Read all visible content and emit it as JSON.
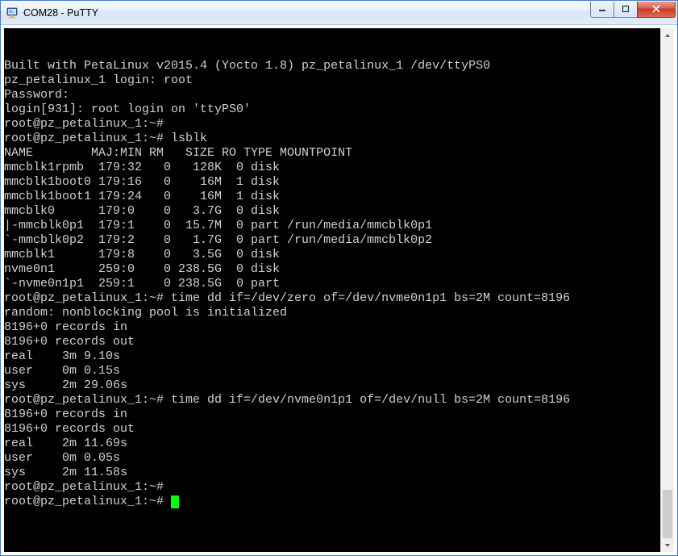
{
  "window": {
    "title": "COM28 - PuTTY"
  },
  "terminal": {
    "lines": [
      "",
      "Built with PetaLinux v2015.4 (Yocto 1.8) pz_petalinux_1 /dev/ttyPS0",
      "pz_petalinux_1 login: root",
      "Password:",
      "login[931]: root login on 'ttyPS0'",
      "root@pz_petalinux_1:~#",
      "root@pz_petalinux_1:~# lsblk",
      "NAME        MAJ:MIN RM   SIZE RO TYPE MOUNTPOINT",
      "mmcblk1rpmb  179:32   0   128K  0 disk",
      "mmcblk1boot0 179:16   0    16M  1 disk",
      "mmcblk1boot1 179:24   0    16M  1 disk",
      "mmcblk0      179:0    0   3.7G  0 disk",
      "|-mmcblk0p1  179:1    0  15.7M  0 part /run/media/mmcblk0p1",
      "`-mmcblk0p2  179:2    0   1.7G  0 part /run/media/mmcblk0p2",
      "mmcblk1      179:8    0   3.5G  0 disk",
      "nvme0n1      259:0    0 238.5G  0 disk",
      "`-nvme0n1p1  259:1    0 238.5G  0 part",
      "root@pz_petalinux_1:~# time dd if=/dev/zero of=/dev/nvme0n1p1 bs=2M count=8196",
      "random: nonblocking pool is initialized",
      "8196+0 records in",
      "8196+0 records out",
      "real    3m 9.10s",
      "user    0m 0.15s",
      "sys     2m 29.06s",
      "root@pz_petalinux_1:~# time dd if=/dev/nvme0n1p1 of=/dev/null bs=2M count=8196",
      "8196+0 records in",
      "8196+0 records out",
      "real    2m 11.69s",
      "user    0m 0.05s",
      "sys     2m 11.58s",
      "root@pz_petalinux_1:~#",
      "root@pz_petalinux_1:~# "
    ]
  }
}
